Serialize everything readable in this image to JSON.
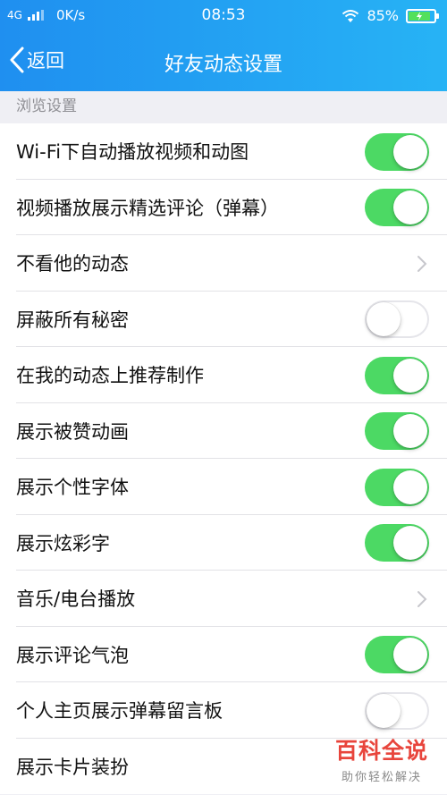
{
  "status_bar": {
    "network": "4G",
    "speed": "0K/s",
    "time": "08:53",
    "battery": "85%",
    "battery_level": 0.85
  },
  "nav": {
    "back_label": "返回",
    "title": "好友动态设置"
  },
  "section": {
    "label": "浏览设置"
  },
  "settings": [
    {
      "label": "Wi-Fi下自动播放视频和动图",
      "control": "toggle",
      "on": true
    },
    {
      "label": "视频播放展示精选评论（弹幕）",
      "control": "toggle",
      "on": true
    },
    {
      "label": "不看他的动态",
      "control": "chevron"
    },
    {
      "label": "屏蔽所有秘密",
      "control": "toggle",
      "on": false
    },
    {
      "label": "在我的动态上推荐制作",
      "control": "toggle",
      "on": true
    },
    {
      "label": "展示被赞动画",
      "control": "toggle",
      "on": true
    },
    {
      "label": "展示个性字体",
      "control": "toggle",
      "on": true
    },
    {
      "label": "展示炫彩字",
      "control": "toggle",
      "on": true
    },
    {
      "label": "音乐/电台播放",
      "control": "chevron"
    },
    {
      "label": "展示评论气泡",
      "control": "toggle",
      "on": true
    },
    {
      "label": "个人主页展示弹幕留言板",
      "control": "toggle",
      "on": false
    },
    {
      "label": "展示卡片装扮",
      "control": "none"
    }
  ],
  "colors": {
    "header_start": "#1f8ff0",
    "header_end": "#27b3f5",
    "toggle_on": "#4cd964",
    "watermark": "#e8453c"
  },
  "watermark": {
    "title": "百科全说",
    "subtitle": "助你轻松解决"
  }
}
